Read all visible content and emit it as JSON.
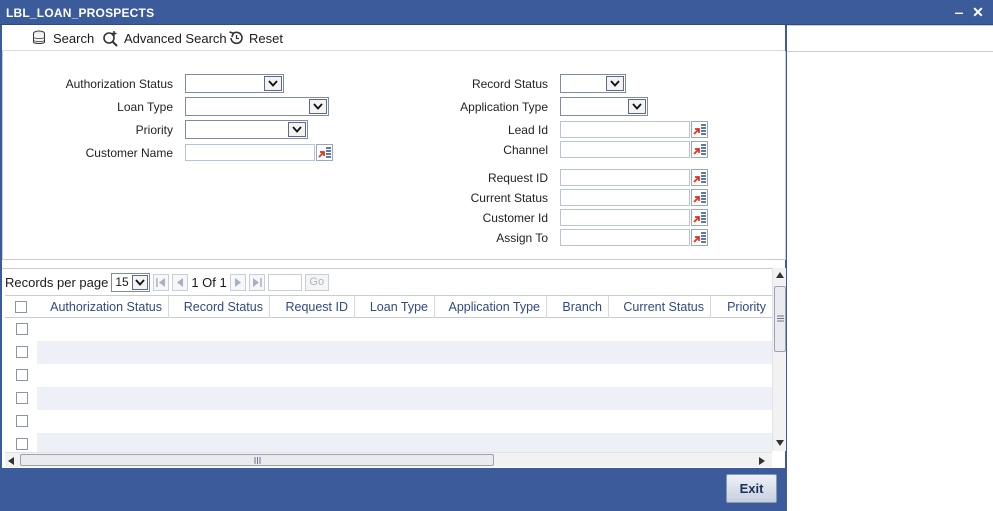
{
  "window": {
    "title": "LBL_LOAN_PROSPECTS",
    "minimize_glyph": "‒",
    "close_glyph": "✕"
  },
  "toolbar": {
    "search_label": "Search",
    "advanced_search_label": "Advanced Search",
    "reset_label": "Reset"
  },
  "criteria": {
    "authorization_status": {
      "label": "Authorization Status",
      "value": ""
    },
    "loan_type": {
      "label": "Loan Type",
      "value": ""
    },
    "priority": {
      "label": "Priority",
      "value": ""
    },
    "customer_name": {
      "label": "Customer Name",
      "value": ""
    },
    "record_status": {
      "label": "Record Status",
      "value": ""
    },
    "application_type": {
      "label": "Application Type",
      "value": ""
    },
    "lead_id": {
      "label": "Lead Id",
      "value": ""
    },
    "channel": {
      "label": "Channel",
      "value": ""
    },
    "request_id": {
      "label": "Request ID",
      "value": ""
    },
    "current_status": {
      "label": "Current Status",
      "value": ""
    },
    "customer_id": {
      "label": "Customer Id",
      "value": ""
    },
    "assign_to": {
      "label": "Assign To",
      "value": ""
    }
  },
  "pager": {
    "records_per_page_label": "Records per page",
    "records_per_page_value": "15",
    "page_info": "1 Of 1",
    "go_label": "Go"
  },
  "grid": {
    "columns": [
      "Authorization Status",
      "Record Status",
      "Request ID",
      "Loan Type",
      "Application Type",
      "Branch",
      "Current Status",
      "Priority"
    ],
    "rows": []
  },
  "footer": {
    "exit_label": "Exit"
  },
  "colors": {
    "titlebar": "#3c5b9a",
    "header_text": "#2f4a82",
    "alt_row": "#edf1f7"
  }
}
